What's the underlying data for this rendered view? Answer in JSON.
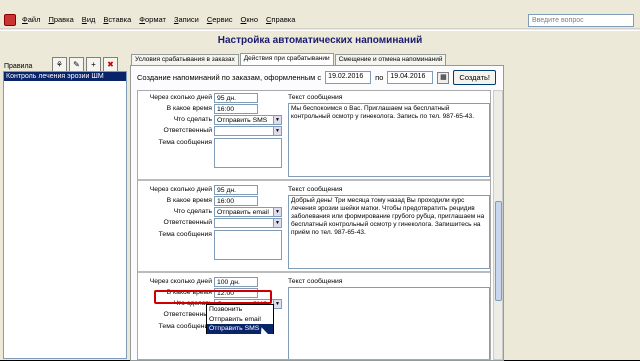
{
  "menubar": {
    "items": [
      "Файл",
      "Правка",
      "Вид",
      "Вставка",
      "Формат",
      "Записи",
      "Сервис",
      "Окно",
      "Справка"
    ],
    "help_placeholder": "Введите вопрос"
  },
  "window": {
    "title": "Настройка автоматических напоминаний"
  },
  "left": {
    "rules_label": "Правила",
    "rules": [
      "Контроль лечения эрозии ШМ"
    ]
  },
  "tabs": [
    {
      "label": "Условия срабатывания в заказах",
      "active": false
    },
    {
      "label": "Действия при срабатывании",
      "active": true
    },
    {
      "label": "Смещение и отмена напоминаний",
      "active": false
    }
  ],
  "create": {
    "label": "Создание напоминаний по заказам, оформленным с",
    "from": "19.02.2016",
    "to_label": "по",
    "to": "19.04.2016",
    "button": "Создать!"
  },
  "labels": {
    "days": "Через сколько дней",
    "time": "В какое время",
    "action": "Что сделать",
    "responsible": "Ответственный",
    "topic": "Тема сообщения",
    "message": "Текст сообщения"
  },
  "reminders": [
    {
      "days": "95 дн.",
      "time": "16:00",
      "action": "Отправить SMS",
      "message": "Мы беспокоимся о Вас. Приглашаем на бесплатный контрольный осмотр у гинеколога. Запись по тел. 987-65-43."
    },
    {
      "days": "95 дн.",
      "time": "16:00",
      "action": "Отправить email",
      "message": "Добрый день! Три месяца тому назад Вы проходили курс лечения эрозии шейки матки. Чтобы предотвратить рецидив заболевания или формирование грубого рубца, приглашаем на бесплатный контрольный осмотр у гинеколога. Запишитесь на приём по тел. 987-65-43."
    },
    {
      "days": "100 дн.",
      "time": "12:00",
      "action": "Отправить SMS",
      "message": ""
    }
  ],
  "dropdown": {
    "options": [
      "Позвонить",
      "Отправить email",
      "Отправить SMS"
    ],
    "selected": "Отправить SMS"
  },
  "colors": {
    "title": "#1a1a6e",
    "highlight": "#cc0000",
    "selection": "#0a246a"
  }
}
